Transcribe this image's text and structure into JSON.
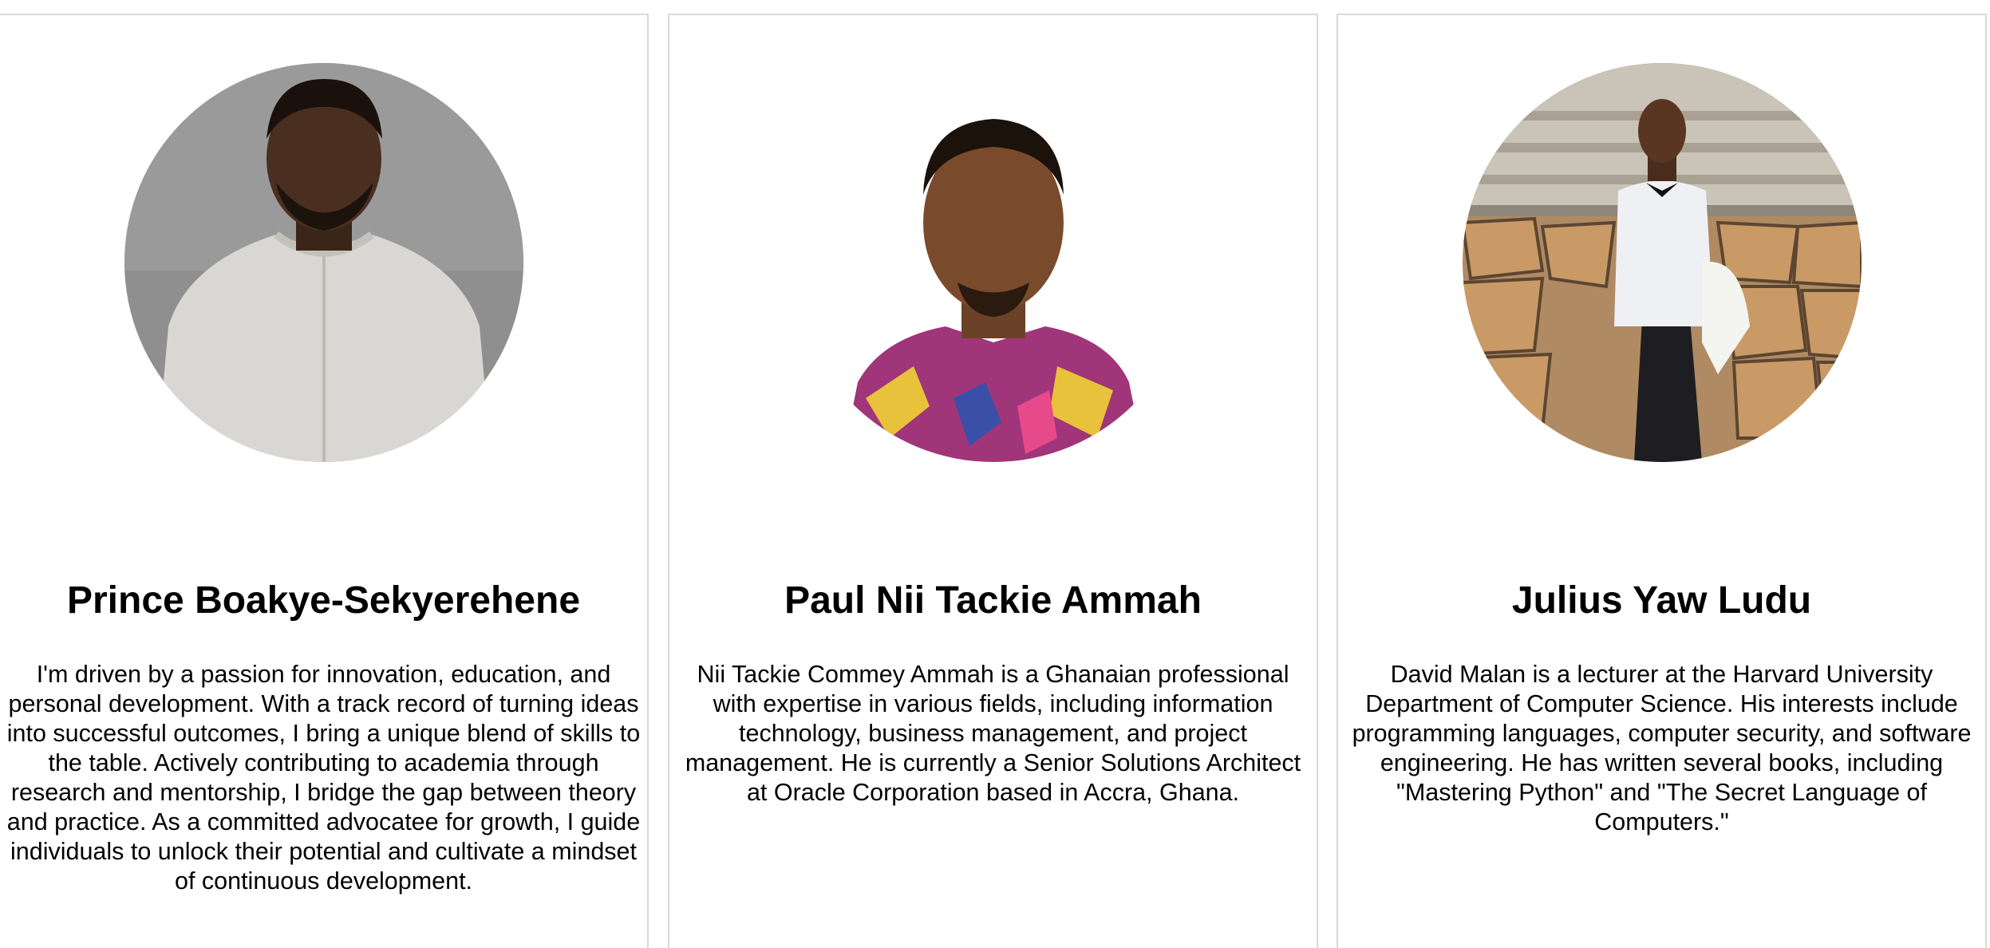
{
  "team": [
    {
      "name": "Prince Boakye-Sekyerehene",
      "bio": "I'm driven by a passion for innovation, education, and personal development. With a track record of turning ideas into successful outcomes, I bring a unique blend of skills to the table. Actively contributing to academia through research and mentorship, I bridge the gap between theory and practice. As a committed advocatee for growth, I guide individuals to unlock their potential and cultivate a mindset of continuous development.",
      "photo_icon": "portrait-photo"
    },
    {
      "name": "Paul Nii Tackie Ammah",
      "bio": "Nii Tackie Commey Ammah is a Ghanaian professional with expertise in various fields, including information technology, business management, and project management. He is currently a Senior Solutions Architect at Oracle Corporation based in Accra, Ghana.",
      "photo_icon": "portrait-photo"
    },
    {
      "name": "Julius Yaw Ludu",
      "bio": "David Malan is a lecturer at the Harvard University Department of Computer Science. His interests include programming languages, computer security, and software engineering. He has written several books, including \"Mastering Python\" and \"The Secret Language of Computers.\"",
      "photo_icon": "portrait-photo"
    }
  ],
  "colors": {
    "card_border": "#d9d9d9",
    "text": "#000000",
    "background": "#ffffff"
  }
}
